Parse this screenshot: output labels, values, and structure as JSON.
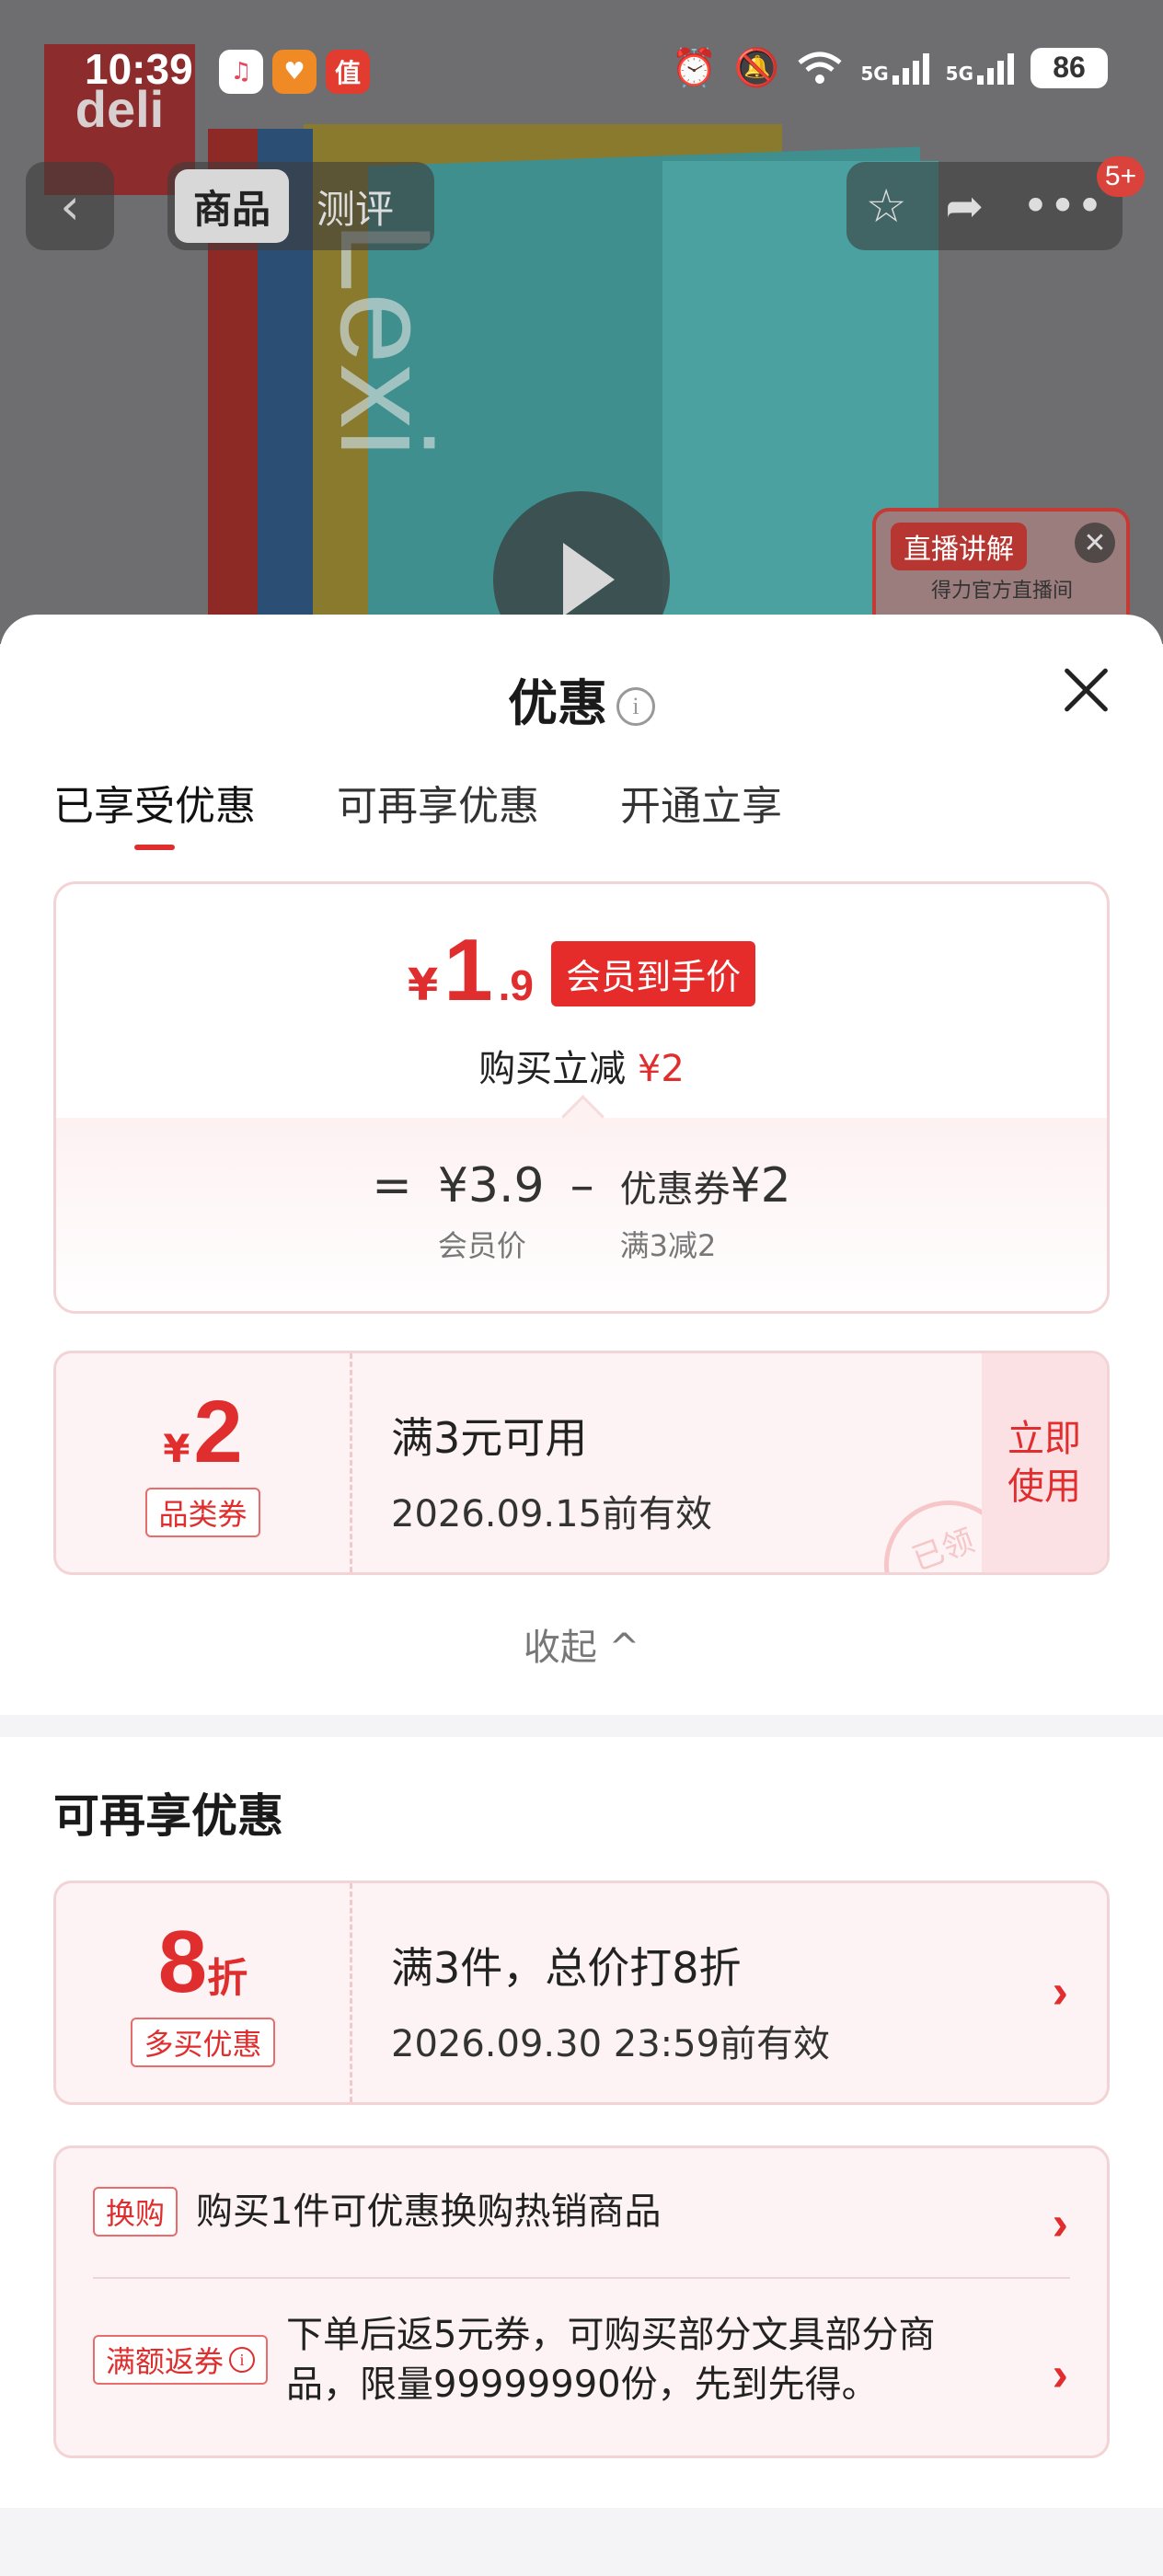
{
  "status_bar": {
    "time": "10:39",
    "app_icons": [
      "music-app-icon",
      "heart-app-icon",
      "zhi-app-icon"
    ],
    "zhi_char": "值",
    "net_label_1": "5G",
    "net_label_2": "5G",
    "battery": "86"
  },
  "background": {
    "brand_logo": "deli",
    "book_text": "Lexi"
  },
  "nav": {
    "back": "‹",
    "tabs": [
      "商品",
      "测评"
    ],
    "active_tab": 0,
    "badge": "5+"
  },
  "live": {
    "tag": "直播讲解",
    "subtitle": "得力官方直播间",
    "close": "✕"
  },
  "sheet": {
    "title": "优惠",
    "info_glyph": "i",
    "tabs": [
      "已享受优惠",
      "可再享优惠",
      "开通立享"
    ],
    "active_tab": 0
  },
  "price_card": {
    "yen": "¥",
    "price_int": "1",
    "price_dec": ".9",
    "badge": "会员到手价",
    "sub_prefix": "购买立减",
    "sub_amount": "¥2",
    "equals": "=",
    "minus": "–",
    "member_price": "¥3.9",
    "member_label": "会员价",
    "coupon_label_prefix": "优惠券",
    "coupon_value": "¥2",
    "coupon_condition": "满3减2"
  },
  "coupon": {
    "yen": "¥",
    "amount": "2",
    "tag": "品类券",
    "title": "满3元可用",
    "date": "2026.09.15前有效",
    "use_label_1": "立即",
    "use_label_2": "使用",
    "stamp": "已领"
  },
  "collapse_label": "收起 ^",
  "more_section": {
    "title": "可再享优惠",
    "deal": {
      "num": "8",
      "unit": "折",
      "tag": "多买优惠",
      "title": "满3件，总价打8折",
      "date": "2026.09.30 23:59前有效"
    },
    "extras": [
      {
        "tag": "换购",
        "text": "购买1件可优惠换购热销商品"
      },
      {
        "tag": "满额返券",
        "text": "下单后返5元券，可购买部分文具部分商品，限量99999990份，先到先得。"
      }
    ],
    "chevron": "›"
  }
}
